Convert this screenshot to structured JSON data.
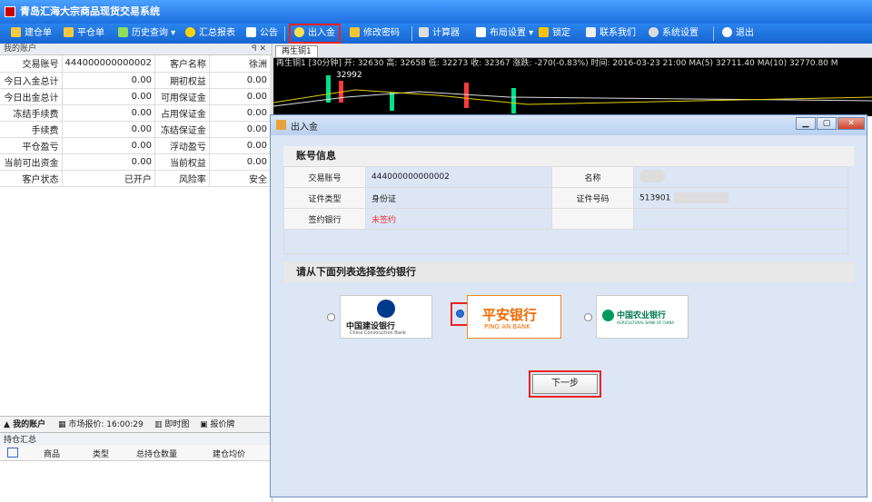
{
  "window": {
    "title": "青岛汇海大宗商品现货交易系统"
  },
  "toolbar": {
    "items": [
      "建仓单",
      "平仓单",
      "历史查询",
      "汇总报表",
      "公告",
      "出入金",
      "修改密码",
      "计算器",
      "布局设置",
      "锁定",
      "联系我们",
      "系统设置",
      "退出"
    ]
  },
  "account": {
    "header": "我的账户",
    "rows": [
      [
        "交易账号",
        "444000000000002",
        "客户名称",
        "徐洲"
      ],
      [
        "今日入金总计",
        "0.00",
        "期初权益",
        "0.00"
      ],
      [
        "今日出金总计",
        "0.00",
        "可用保证金",
        "0.00"
      ],
      [
        "冻结手续费",
        "0.00",
        "占用保证金",
        "0.00"
      ],
      [
        "手续费",
        "0.00",
        "冻结保证金",
        "0.00"
      ],
      [
        "平仓盈亏",
        "0.00",
        "浮动盈亏",
        "0.00"
      ],
      [
        "当前可出资金",
        "0.00",
        "当前权益",
        "0.00"
      ],
      [
        "客户状态",
        "已开户",
        "风险率",
        "安全"
      ]
    ]
  },
  "bottom": {
    "tabs": [
      "我的账户",
      "市场报价: 16:00:29",
      "即时图",
      "报价牌"
    ],
    "holding_title": "持仓汇总",
    "cols": [
      "商品",
      "类型",
      "总持仓数量",
      "建仓均价"
    ]
  },
  "chart": {
    "tab": "再生铜1",
    "info": "再生铜1 [30分钟] 开: 32630 高: 32658 低: 32273 收: 32367 涨跌: -270(-0.83%) 时间: 2016-03-23 21:00 MA(5) 32711.40 MA(10) 32770.80 M",
    "price_label": "32992"
  },
  "dialog": {
    "title": "出入金",
    "section1": "账号信息",
    "labels": {
      "acct": "交易账号",
      "acct_val": "444000000000002",
      "name": "名称",
      "id_type": "证件类型",
      "id_type_val": "身份证",
      "id_no": "证件号码",
      "id_no_val": "513901",
      "bank": "签约银行",
      "bank_val": "未签约"
    },
    "section2": "请从下面列表选择签约银行",
    "next": "下一步"
  },
  "banks": {
    "ccb_cn": "中国建设银行",
    "ccb_en": "China Construction Bank",
    "pingan_cn": "平安银行",
    "pingan_en": "PING AN BANK",
    "abc_cn": "中国农业银行",
    "abc_en": "AGRICULTURAL BANK OF CHINA"
  }
}
